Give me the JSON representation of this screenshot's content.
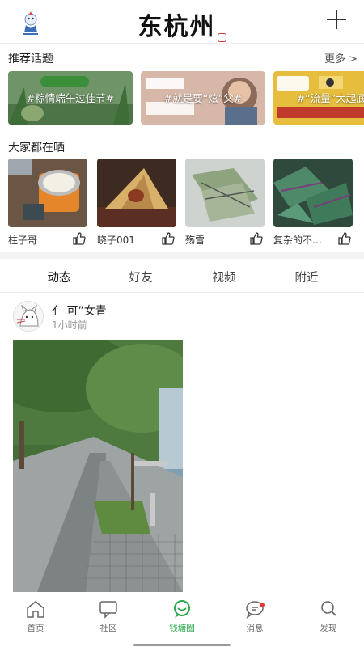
{
  "header": {
    "brand": "东杭州",
    "mascot_icon": "mascot-logo-icon",
    "add_icon": "plus-icon"
  },
  "topics_section": {
    "title": "推荐话题",
    "more": "更多 >",
    "items": [
      {
        "label": "#粽情端午过佳节#",
        "bg": "#5e8a5a"
      },
      {
        "label": "#就是要“炫”父#",
        "bg": "#c9a69a"
      },
      {
        "label": "#“流量”大起底#",
        "bg": "#e0b83a"
      }
    ]
  },
  "shares_section": {
    "title": "大家都在晒",
    "items": [
      {
        "name": "柱子哥"
      },
      {
        "name": "晓子001"
      },
      {
        "name": "殇雪"
      },
      {
        "name": "复杂的不…"
      }
    ]
  },
  "feed_tabs": [
    "动态",
    "好友",
    "视频",
    "附近"
  ],
  "post": {
    "author": "亻 可”女青",
    "time": "1小时前"
  },
  "bottom_nav": [
    {
      "label": "首页",
      "icon": "home-icon"
    },
    {
      "label": "社区",
      "icon": "community-icon"
    },
    {
      "label": "钱塘圈",
      "icon": "qiantang-circle-icon"
    },
    {
      "label": "消息",
      "icon": "message-icon"
    },
    {
      "label": "发现",
      "icon": "search-icon"
    }
  ],
  "colors": {
    "accent": "#2aa84a",
    "badge": "#e53935"
  }
}
